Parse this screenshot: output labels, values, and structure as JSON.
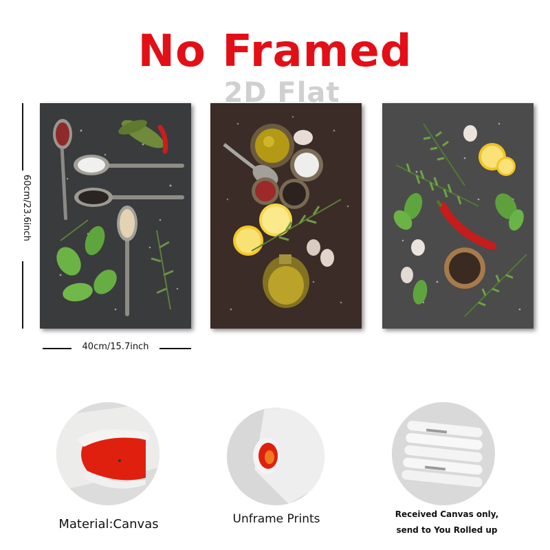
{
  "header": {
    "title": "No Framed",
    "title_color": "#e30f17",
    "watermark": "2D Flat"
  },
  "dimensions": {
    "height_label": "60cm/23.6inch",
    "width_label": "40cm/15.7inch"
  },
  "panels": [
    {
      "subject": "spoons with spices, basil and rosemary on dark slate"
    },
    {
      "subject": "bowls of olive oil and salt, lemon, peppercorns and rosemary"
    },
    {
      "subject": "rosemary, lemon, red chili, basil, garlic and pepper bowl"
    }
  ],
  "features": [
    {
      "caption": "Material:Canvas"
    },
    {
      "caption": "Unframe  Prints"
    },
    {
      "caption_line1": "Received Canvas only,",
      "caption_line2": "send to You Rolled up"
    }
  ],
  "colors": {
    "canvas_red": "#e0200e",
    "slate": "#3c3c3d",
    "basil": "#5aa63a",
    "lemon": "#f3c928"
  }
}
